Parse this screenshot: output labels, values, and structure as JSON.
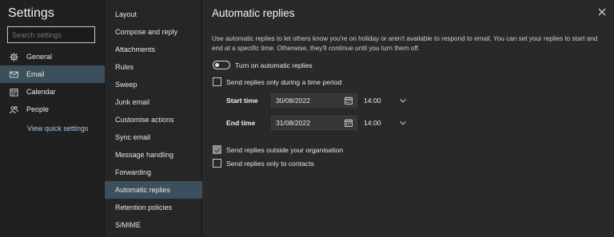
{
  "sidebar": {
    "title": "Settings",
    "search_placeholder": "Search settings",
    "items": [
      {
        "label": "General",
        "icon": "gear-icon"
      },
      {
        "label": "Email",
        "icon": "mail-icon",
        "selected": true
      },
      {
        "label": "Calendar",
        "icon": "calendar-icon"
      },
      {
        "label": "People",
        "icon": "people-icon"
      }
    ],
    "quick_settings_link": "View quick settings"
  },
  "email_menu": {
    "items": [
      "Layout",
      "Compose and reply",
      "Attachments",
      "Rules",
      "Sweep",
      "Junk email",
      "Customise actions",
      "Sync email",
      "Message handling",
      "Forwarding",
      "Automatic replies",
      "Retention policies",
      "S/MIME"
    ],
    "selected": "Automatic replies"
  },
  "panel": {
    "title": "Automatic replies",
    "description": "Use automatic replies to let others know you're on holiday or aren't available to respond to email. You can set your replies to start and end at a specific time. Otherwise, they'll continue until you turn them off.",
    "toggle_label": "Turn on automatic replies",
    "toggle_on": false,
    "time_period_label": "Send replies only during a time period",
    "time_period_checked": false,
    "start_label": "Start time",
    "start_date": "30/08/2022",
    "start_time": "14:00",
    "end_label": "End time",
    "end_date": "31/08/2022",
    "end_time": "14:00",
    "outside_org_label": "Send replies outside your organisation",
    "outside_org_checked": true,
    "contacts_only_label": "Send replies only to contacts",
    "contacts_only_checked": false
  },
  "colors": {
    "selected_bg": "#3b4f5c",
    "link": "#a9c9e8"
  }
}
